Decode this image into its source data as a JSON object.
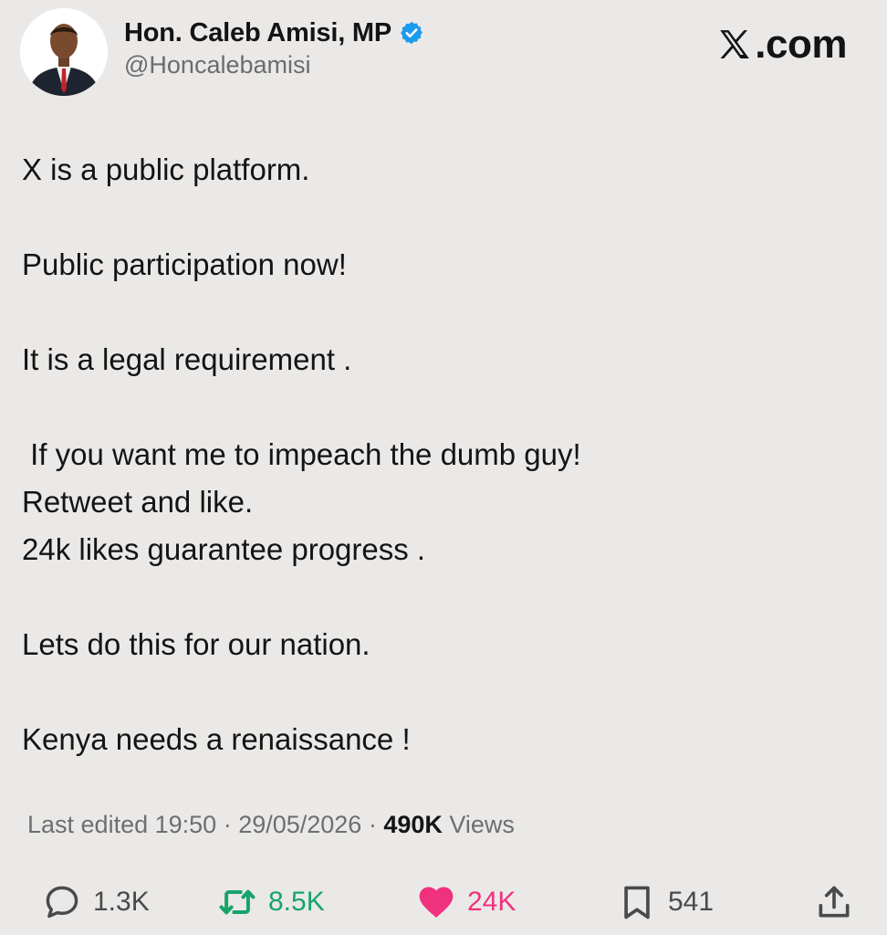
{
  "author": {
    "display_name": "Hon. Caleb Amisi, MP",
    "handle": "@Honcalebamisi",
    "verified_icon": "verified-badge-icon",
    "avatar": "profile-photo"
  },
  "brand": {
    "label": ".com",
    "logo_icon": "x-logo-icon"
  },
  "tweet": {
    "paragraphs": [
      "X is a public platform.",
      "Public participation now!",
      "It is a legal requirement .",
      " If you want me to impeach the dumb guy!\nRetweet and like.\n24k likes guarantee progress .",
      "Lets do this for our nation.",
      "Kenya needs a renaissance !"
    ]
  },
  "meta": {
    "edited_prefix": "Last edited ",
    "time": "19:50",
    "sep1": " · ",
    "date": "29/05/2026",
    "sep2": " · ",
    "views_count": "490K",
    "views_label": " Views"
  },
  "actions": {
    "replies": {
      "icon": "reply-icon",
      "count": "1.3K",
      "color": "#4a4a4a"
    },
    "reposts": {
      "icon": "repost-icon",
      "count": "8.5K",
      "color": "#17a46b"
    },
    "likes": {
      "icon": "heart-icon",
      "count": "24K",
      "color": "#f0317e"
    },
    "bookmarks": {
      "icon": "bookmark-icon",
      "count": "541",
      "color": "#4a4a4a"
    },
    "share": {
      "icon": "share-icon"
    }
  },
  "colors": {
    "background": "#ebe9e7",
    "text": "#141414",
    "secondary_text": "#6e6e6e",
    "verified": "#1d9bf0",
    "repost": "#17a46b",
    "like": "#f0317e"
  }
}
